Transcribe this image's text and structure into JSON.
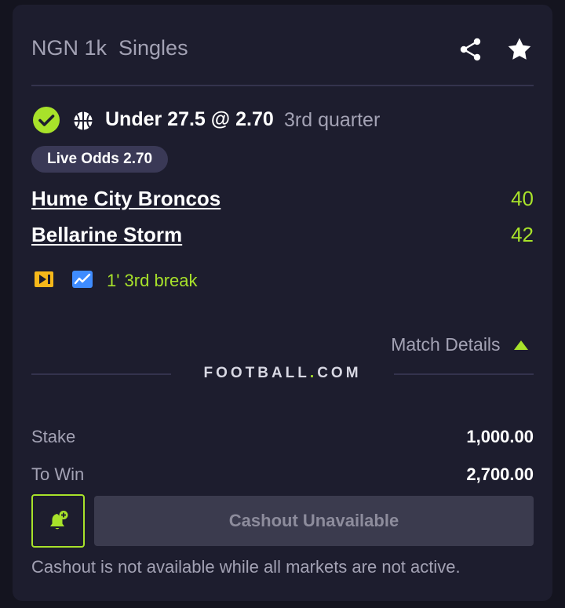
{
  "header": {
    "title": "NGN 1k  Singles",
    "share_icon": "share-icon",
    "favorite_icon": "star-icon"
  },
  "selection": {
    "status_icon": "check-circle-icon",
    "sport_icon": "basketball-icon",
    "pick": "Under 27.5 @ 2.70",
    "period": "3rd quarter",
    "live_odds": "Live Odds 2.70"
  },
  "teams": [
    {
      "name": "Hume City Broncos",
      "score": "40"
    },
    {
      "name": "Bellarine Storm",
      "score": "42"
    }
  ],
  "match_status": {
    "stream_icon": "stream-icon",
    "stats_icon": "stats-chart-icon",
    "text": "1' 3rd break"
  },
  "match_details": {
    "label": "Match Details",
    "icon": "caret-up-icon"
  },
  "brand": {
    "name_part1": "FOOTBALL",
    "dot": ".",
    "name_part2": "COM"
  },
  "summary": {
    "stake_label": "Stake",
    "stake_value": "1,000.00",
    "to_win_label": "To Win",
    "to_win_value": "2,700.00"
  },
  "cashout": {
    "bell_icon": "bell-plus-icon",
    "button_label": "Cashout Unavailable",
    "note": "Cashout is not available while all markets are not active."
  },
  "colors": {
    "background": "#14141f",
    "card": "#1d1d2e",
    "accent_green": "#a8e22a",
    "muted_text": "#a3a2b4",
    "pill": "#3a3956",
    "disabled_button": "#3b3b4e",
    "stream_icon": "#f6b81a",
    "stats_icon": "#3f8cff"
  }
}
